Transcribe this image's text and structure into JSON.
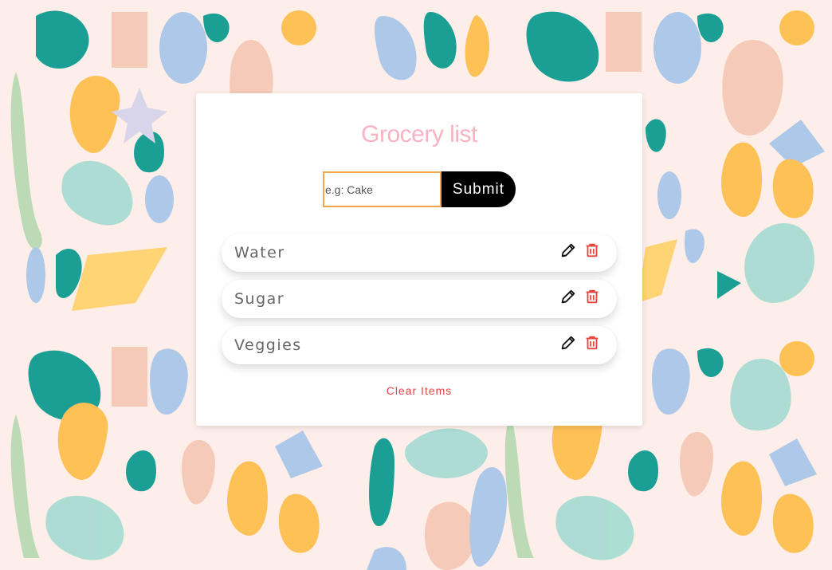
{
  "app": {
    "title": "Grocery list"
  },
  "form": {
    "placeholder": "e.g: Cake",
    "value": "",
    "submit_label": "Submit"
  },
  "items": [
    {
      "name": "Water"
    },
    {
      "name": "Sugar"
    },
    {
      "name": "Veggies"
    }
  ],
  "icons": {
    "edit": "pencil-icon",
    "delete": "trash-icon"
  },
  "actions": {
    "clear_label": "Clear Items"
  },
  "colors": {
    "title": "#f8b3c2",
    "input_border": "#f0a64a",
    "submit_bg": "#000000",
    "delete_icon": "#e3463e",
    "clear_text": "#e3463e",
    "background": "#fdeee9"
  }
}
